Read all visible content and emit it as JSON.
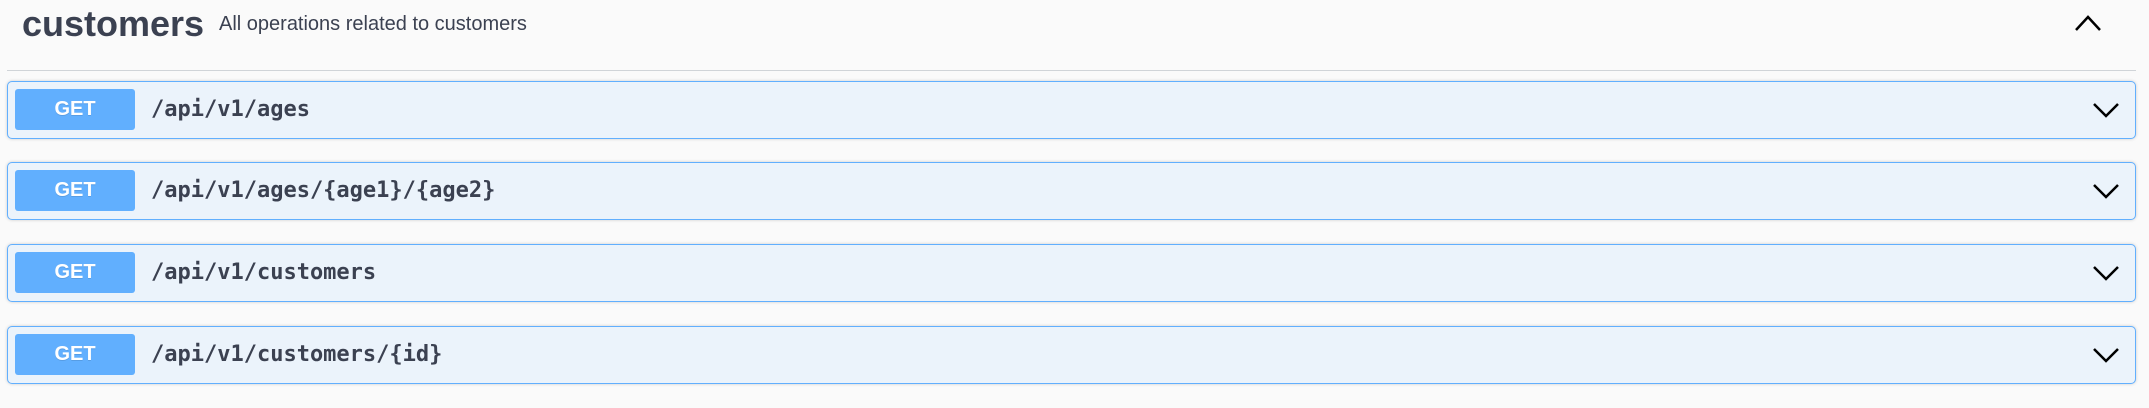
{
  "section": {
    "title": "customers",
    "description": "All operations related to customers",
    "collapse_icon": "chevron-up-icon"
  },
  "operations": [
    {
      "method": "GET",
      "path": "/api/v1/ages",
      "expand_icon": "chevron-down-icon"
    },
    {
      "method": "GET",
      "path": "/api/v1/ages/{age1}/{age2}",
      "expand_icon": "chevron-down-icon"
    },
    {
      "method": "GET",
      "path": "/api/v1/customers",
      "expand_icon": "chevron-down-icon"
    },
    {
      "method": "GET",
      "path": "/api/v1/customers/{id}",
      "expand_icon": "chevron-down-icon"
    }
  ],
  "colors": {
    "get_accent": "#61affe",
    "get_background": "#ebf3fb",
    "text": "#3b4151",
    "page_background": "#fafafa"
  }
}
